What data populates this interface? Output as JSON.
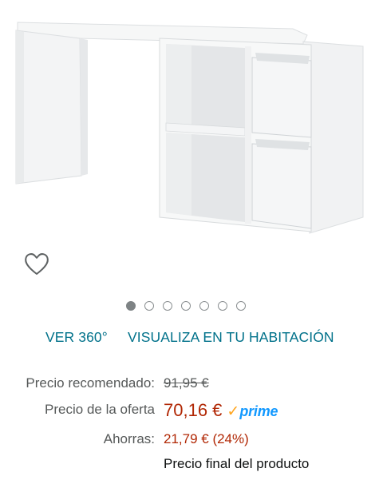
{
  "image": {
    "icon": "desk-product-image",
    "wishlist_icon": "heart-outline-icon"
  },
  "carousel": {
    "total": 7,
    "active_index": 0
  },
  "links": {
    "view360": "VER 360°",
    "view_in_room": "VISUALIZA EN TU HABITACIÓN"
  },
  "pricing": {
    "recommended_label": "Precio recomendado:",
    "recommended_value": "91,95 €",
    "offer_label": "Precio de la oferta",
    "offer_value": "70,16 €",
    "prime_check": "✓",
    "prime_label": "prime",
    "savings_label": "Ahorras:",
    "savings_value": "21,79 € (24%)",
    "final_note": "Precio final del producto"
  },
  "colors": {
    "link": "#00718a",
    "price": "#b12704",
    "prime_blue": "#1399ff",
    "prime_orange": "#ffa41c"
  }
}
